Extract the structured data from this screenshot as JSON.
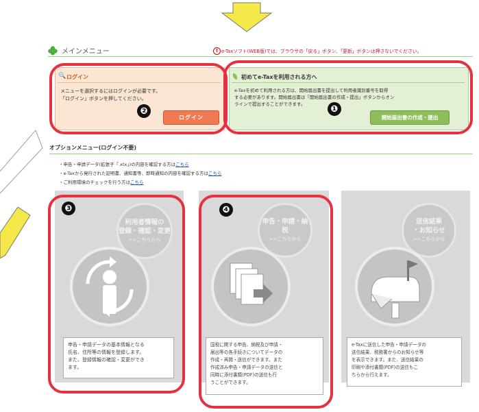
{
  "menu": {
    "title": "メインメニュー",
    "warning": "e-Taxソフト(WEB版)では、ブラウザの「戻る」ボタン、「更新」ボタンは押さないでください。"
  },
  "login_box": {
    "title": "ログイン",
    "text_line1": "メニューを選択するにはログインが必要です。",
    "text_line2": "「ログイン」ボタンを押してください。",
    "button": "ログイン"
  },
  "first_box": {
    "title": "初めてe-Taxを利用される方へ",
    "text_line1": "e-Taxを初めて利用される方は、開始届出書を提出して利用者識別番号を取得",
    "text_line2": "する必要があります。開始届出書は「開始届出書の作成・提出」ボタンからオン",
    "text_line3": "ラインで提出することができます。",
    "button": "開始届出書の作成・提出"
  },
  "options": {
    "heading": "オプションメニュー(ログイン不要)",
    "line1_text": "・申告・申請データ(拡張子「.xtx」)の内容を確認する方は",
    "line1_link": "こちら",
    "line2_text": "・e-Taxから発行された証明書、通知書等、即時通知の内容を確認する方は",
    "line2_link": "こちら",
    "line3_text": "・ご利用環境のチェックを行う方は",
    "line3_link": "こちら"
  },
  "panels": [
    {
      "label_line1": "利用者情報の",
      "label_line2": "登録・確認・変更",
      "label_sub": ">>こちらから",
      "desc": [
        "申告・申請データの基本情報となる",
        "氏名、住所等の情報を登録します。",
        "また、登録情報の確認・変更ができ",
        "ます。"
      ]
    },
    {
      "label_line1": "申告・申請・納税",
      "label_line2": "",
      "label_sub": ">>こちらから",
      "desc": [
        "国税に関する申告、納税及び申請・",
        "届出等の各手続きについてデータの",
        "作成・再開・送信ができます。また",
        "作成済み申告・申請データの送信と",
        "同時に添付書類(PDF)の送信も行",
        "うことができます。"
      ]
    },
    {
      "label_line1": "送信結果",
      "label_line2": "・お知らせ",
      "label_sub": ">>こちらから",
      "desc": [
        "e-Taxに送信した申告・申請データの",
        "送信結果、税務署からのお知らせ等",
        "を表示できます。また、送信結果の",
        "印刷や添付書類(PDF)の送信もこ",
        "ちらから行えます。"
      ]
    }
  ],
  "markers": [
    "❶",
    "❷",
    "❸",
    "❹"
  ],
  "colors": {
    "highlight": "#e5303f",
    "arrow": "#f4e84a",
    "login_bg": "#fbe5d3",
    "first_bg": "#e3f0d6",
    "button_orange": "#f07b52",
    "button_green": "#8cbf5a",
    "panel_gray": "#d9d9d9"
  }
}
